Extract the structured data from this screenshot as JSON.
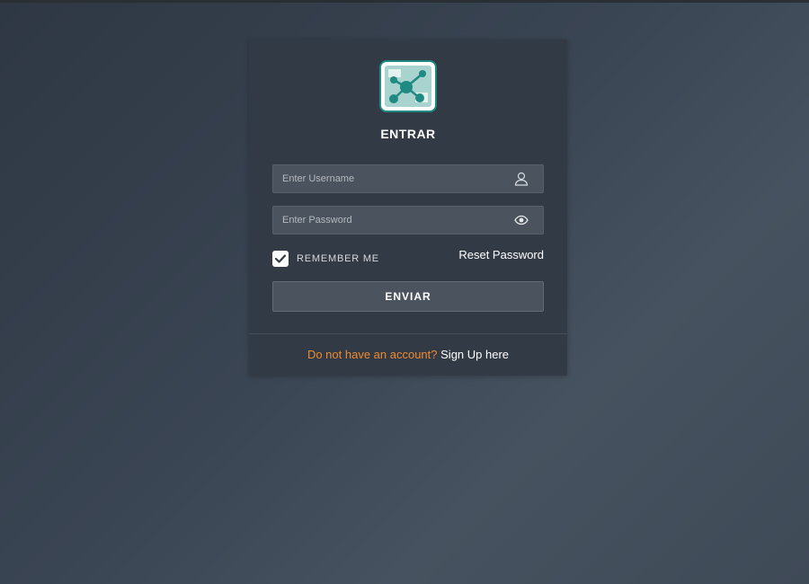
{
  "login": {
    "title": "ENTRAR",
    "username_placeholder": "Enter Username",
    "password_placeholder": "Enter Password",
    "remember_label": "REMEMBER ME",
    "remember_checked": true,
    "reset_label": "Reset Password",
    "submit_label": "ENVIAR",
    "signup_prompt": "Do not have an account?",
    "signup_link": "Sign Up here"
  },
  "icons": {
    "logo": "network-graph-logo",
    "username": "user-icon",
    "password": "eye-icon",
    "checkbox": "check-icon"
  },
  "colors": {
    "card": "#323a45",
    "field": "#4b535e",
    "accent_orange": "#ef8a2f",
    "logo_teal": "#1f8a82"
  }
}
